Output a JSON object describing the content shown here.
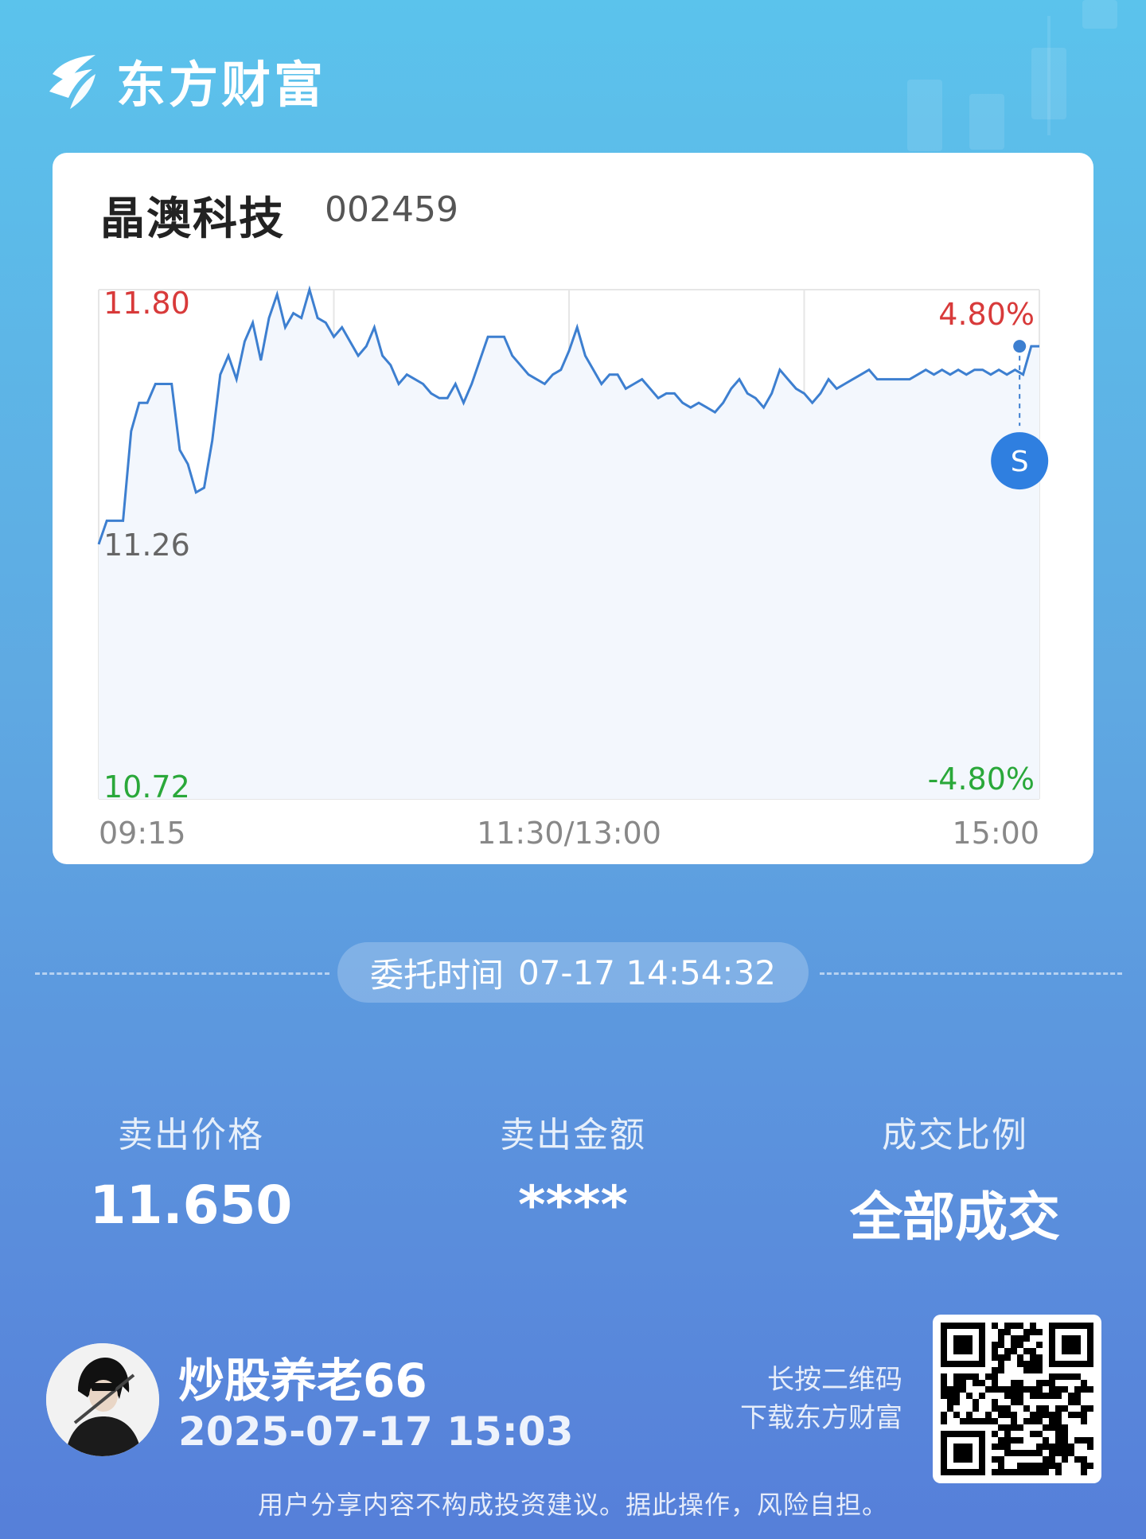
{
  "brand": {
    "name": "东方财富",
    "color": "#ffffff"
  },
  "stock": {
    "name": "晶澳科技",
    "code": "002459"
  },
  "chart_data": {
    "type": "line",
    "title": "",
    "xlabel": "",
    "ylabel": "",
    "y_labels": {
      "top": "11.80",
      "mid": "11.26",
      "bottom": "10.72"
    },
    "pct_labels": {
      "top": "4.80%",
      "bottom": "-4.80%"
    },
    "x_labels": [
      "09:15",
      "11:30/13:00",
      "15:00"
    ],
    "ylim": [
      10.72,
      11.8
    ],
    "grid": true,
    "colors": {
      "line": "#3d7fd0",
      "up": "#d83a3a",
      "down": "#2aa83a",
      "neutral": "#666666",
      "fill": "#f3f7fd"
    },
    "series": [
      {
        "values": [
          11.26,
          11.31,
          11.31,
          11.31,
          11.5,
          11.56,
          11.56,
          11.6,
          11.6,
          11.6,
          11.46,
          11.43,
          11.37,
          11.38,
          11.48,
          11.62,
          11.66,
          11.61,
          11.69,
          11.73,
          11.65,
          11.74,
          11.79,
          11.72,
          11.75,
          11.74,
          11.8,
          11.74,
          11.73,
          11.7,
          11.72,
          11.69,
          11.66,
          11.68,
          11.72,
          11.66,
          11.64,
          11.6,
          11.62,
          11.61,
          11.6,
          11.58,
          11.57,
          11.57,
          11.6,
          11.56,
          11.6,
          11.65,
          11.7,
          11.7,
          11.7,
          11.66,
          11.64,
          11.62,
          11.61,
          11.6,
          11.62,
          11.63,
          11.67,
          11.72,
          11.66,
          11.63,
          11.6,
          11.62,
          11.62,
          11.59,
          11.6,
          11.61,
          11.59,
          11.57,
          11.58,
          11.58,
          11.56,
          11.55,
          11.56,
          11.55,
          11.54,
          11.56,
          11.59,
          11.61,
          11.58,
          11.57,
          11.55,
          11.58,
          11.63,
          11.61,
          11.59,
          11.58,
          11.56,
          11.58,
          11.61,
          11.59,
          11.6,
          11.61,
          11.62,
          11.63,
          11.61,
          11.61,
          11.61,
          11.61,
          11.61,
          11.62,
          11.63,
          11.62,
          11.63,
          11.62,
          11.63,
          11.62,
          11.63,
          11.63,
          11.62,
          11.63,
          11.62,
          11.63,
          11.62,
          11.68,
          11.68
        ]
      }
    ],
    "marker": {
      "label": "S",
      "time_fraction": 0.979,
      "value": 11.68,
      "color": "#2f7fe0"
    }
  },
  "order": {
    "label": "委托时间",
    "time": "07-17 14:54:32"
  },
  "stats": [
    {
      "label": "卖出价格",
      "value": "11.650"
    },
    {
      "label": "卖出金额",
      "value": "****"
    },
    {
      "label": "成交比例",
      "value": "全部成交"
    }
  ],
  "user": {
    "name": "炒股养老66",
    "time": "2025-07-17 15:03"
  },
  "qr_hint": {
    "line1": "长按二维码",
    "line2": "下载东方财富"
  },
  "disclaimer": "用户分享内容不构成投资建议。据此操作，风险自担。"
}
